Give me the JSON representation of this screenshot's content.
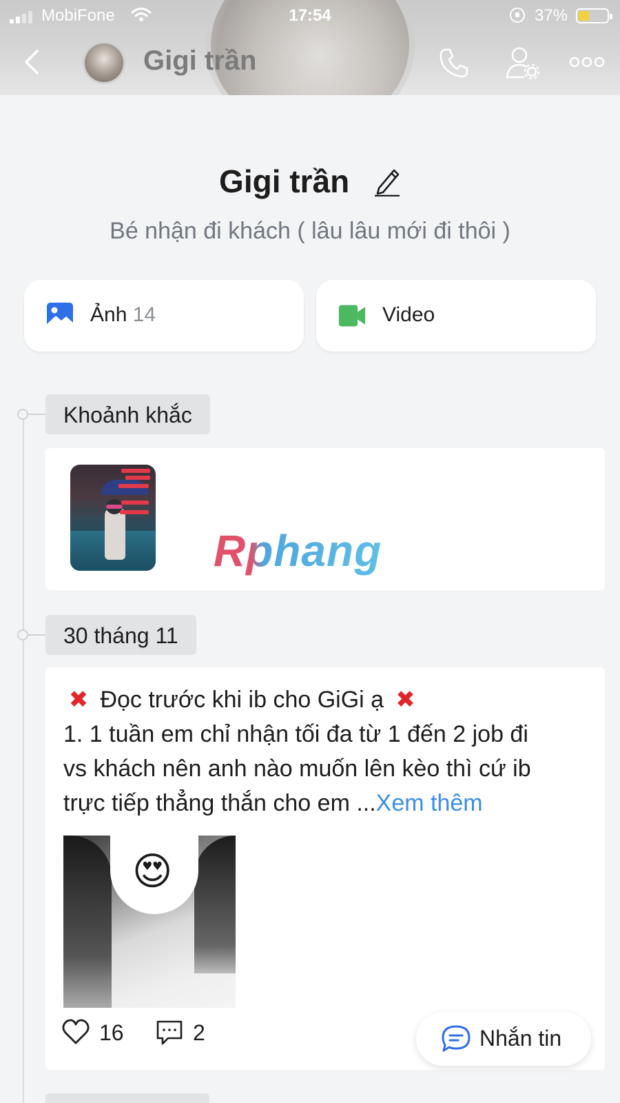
{
  "status_bar": {
    "carrier": "MobiFone",
    "time": "17:54",
    "battery_percent": "37%",
    "battery_level": 0.37
  },
  "nav": {
    "title": "Gigi trần",
    "back_icon": "chevron-left-icon",
    "call_icon": "phone-icon",
    "settings_icon": "user-gear-icon",
    "more_icon": "more-dots-icon"
  },
  "profile": {
    "name": "Gigi trần",
    "bio": "Bé nhận đi khách ( lâu lâu mới đi thôi )"
  },
  "media": {
    "photos_label": "Ảnh",
    "photos_count": "14",
    "video_label": "Video"
  },
  "timeline": {
    "moments_label": "Khoảnh khắc",
    "post_date": "30 tháng 11"
  },
  "watermark": "Rphang",
  "post": {
    "line1": "Đọc trước khi ib cho GiGi ạ",
    "line2": "1. 1 tuần em chỉ nhận tối đa từ 1 đến 2 job đi",
    "line3": "vs khách nên anh nào muốn lên kèo thì cứ ib",
    "line4": "trực tiếp thẳng thắn cho em ...",
    "see_more": "Xem thêm",
    "emoji": "😍",
    "likes": "16",
    "comments": "2"
  },
  "message_button": {
    "label": "Nhắn tin"
  },
  "colors": {
    "accent_blue": "#3a8ee6",
    "photo_icon": "#2f6fe8",
    "video_icon": "#4cb860",
    "cross_red": "#e0262c"
  }
}
